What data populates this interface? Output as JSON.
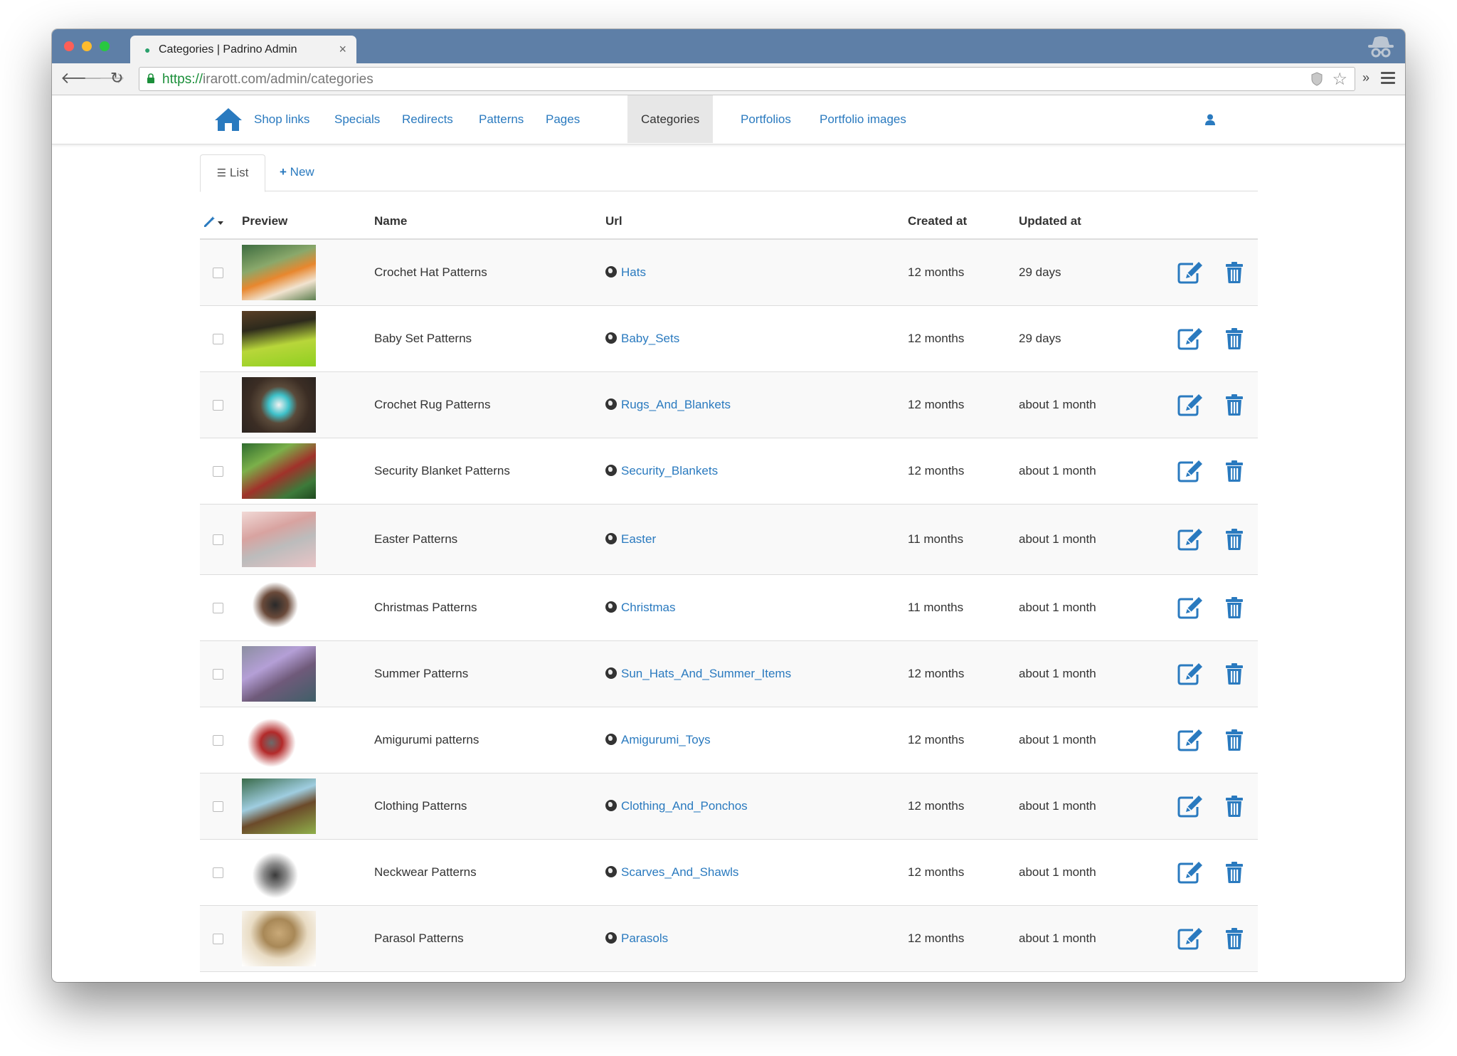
{
  "browser": {
    "tab_title": "Categories | Padrino Admin",
    "tab_close": "×",
    "url_scheme": "https://",
    "url_rest": "irarott.com/admin/categories",
    "ext_label": "»"
  },
  "nav": {
    "items": [
      {
        "label": "Shop links"
      },
      {
        "label": "Specials"
      },
      {
        "label": "Redirects"
      },
      {
        "label": "Patterns"
      },
      {
        "label": "Pages"
      },
      {
        "label": "Categories",
        "active": true
      },
      {
        "label": "Portfolios"
      },
      {
        "label": "Portfolio images"
      }
    ]
  },
  "subtabs": {
    "list_label": "List",
    "new_label": "New"
  },
  "table": {
    "headers": {
      "preview": "Preview",
      "name": "Name",
      "url": "Url",
      "created": "Created at",
      "updated": "Updated at"
    },
    "rows": [
      {
        "name": "Crochet Hat Patterns",
        "url": "Hats",
        "created": "12 months",
        "updated": "29 days"
      },
      {
        "name": "Baby Set Patterns",
        "url": "Baby_Sets",
        "created": "12 months",
        "updated": "29 days"
      },
      {
        "name": "Crochet Rug Patterns",
        "url": "Rugs_And_Blankets",
        "created": "12 months",
        "updated": "about 1 month"
      },
      {
        "name": "Security Blanket Patterns",
        "url": "Security_Blankets",
        "created": "12 months",
        "updated": "about 1 month"
      },
      {
        "name": "Easter Patterns",
        "url": "Easter",
        "created": "11 months",
        "updated": "about 1 month"
      },
      {
        "name": "Christmas Patterns",
        "url": "Christmas",
        "created": "11 months",
        "updated": "about 1 month"
      },
      {
        "name": "Summer Patterns",
        "url": "Sun_Hats_And_Summer_Items",
        "created": "12 months",
        "updated": "about 1 month"
      },
      {
        "name": "Amigurumi patterns",
        "url": "Amigurumi_Toys",
        "created": "12 months",
        "updated": "about 1 month"
      },
      {
        "name": "Clothing Patterns",
        "url": "Clothing_And_Ponchos",
        "created": "12 months",
        "updated": "about 1 month"
      },
      {
        "name": "Neckwear Patterns",
        "url": "Scarves_And_Shawls",
        "created": "12 months",
        "updated": "about 1 month"
      },
      {
        "name": "Parasol Patterns",
        "url": "Parasols",
        "created": "12 months",
        "updated": "about 1 month"
      }
    ]
  },
  "colors": {
    "accent": "#2a7abf",
    "titlebar": "#5e7fa7",
    "active_nav_bg": "#e7e7e7",
    "row_stripe": "#f9f9f9"
  },
  "icons": [
    "home-icon",
    "user-icon",
    "list-icon",
    "plus-icon",
    "wand-icon",
    "caret-down-icon",
    "globe-icon",
    "edit-icon",
    "trash-icon",
    "lock-icon",
    "star-icon",
    "shield-icon",
    "menu-icon",
    "back-icon",
    "forward-icon",
    "reload-icon",
    "incognito-icon"
  ]
}
